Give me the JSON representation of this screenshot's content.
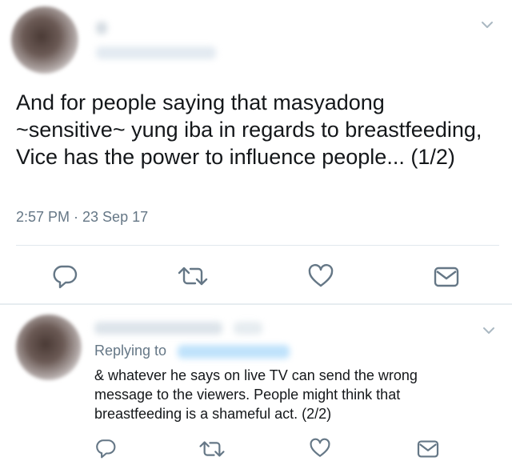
{
  "tweet1": {
    "author_name": "",
    "author_handle": "",
    "text": "And for people saying that masyadong ~sensitive~ yung iba in regards to breastfeeding, Vice has the power to influence people... (1/2)",
    "timestamp": "2:57 PM · 23 Sep 17"
  },
  "tweet2": {
    "author_name": "",
    "author_handle": "",
    "replying_to_label": "Replying to",
    "replying_to_handle": "",
    "text": "& whatever he says on live TV can send the wrong message to the viewers. People might think that breastfeeding is a shameful act. (2/2)"
  },
  "icons": {
    "reply": "reply-icon",
    "retweet": "retweet-icon",
    "like": "heart-icon",
    "message": "direct-message-icon",
    "menu": "chevron-down-icon"
  },
  "colors": {
    "text": "#14171a",
    "secondary": "#657786",
    "link": "#1da1f2",
    "icon": "#657786",
    "divider": "#e1e8ed"
  }
}
